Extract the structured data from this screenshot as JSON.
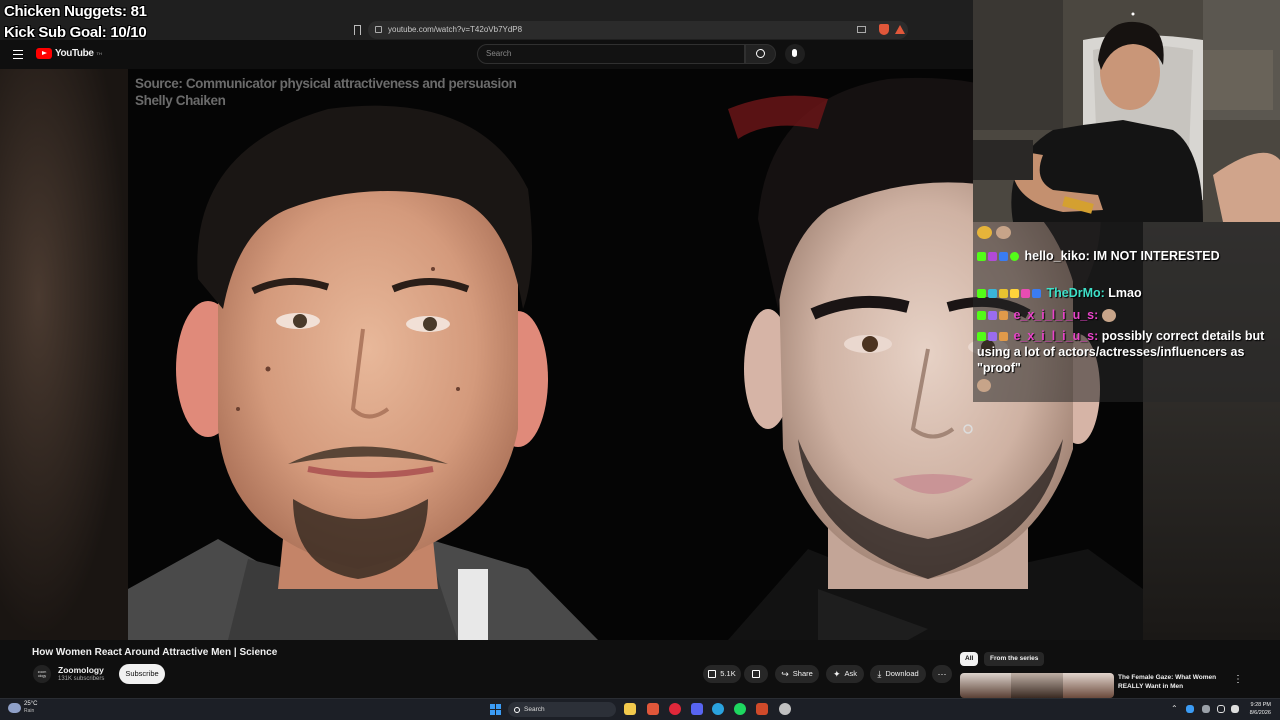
{
  "stream_overlay": {
    "nuggets": "Chicken Nuggets: 81",
    "kick_goal": "Kick Sub Goal: 10/10"
  },
  "browser": {
    "url": "youtube.com/watch?v=T42oVb7YdP8"
  },
  "youtube_header": {
    "logo_text": "YouTube",
    "logo_sup": "TH",
    "search_placeholder": "Search"
  },
  "video": {
    "source_line1": "Source: Communicator physical attractiveness and persuasion",
    "source_line2": "Shelly Chaiken",
    "title": "How Women React Around Attractive Men | Science"
  },
  "channel": {
    "logo_text": "zoom ology",
    "name": "Zoomology",
    "subscribers": "131K subscribers",
    "subscribe_label": "Subscribe"
  },
  "actions": {
    "likes": "5.1K",
    "share": "Share",
    "ask": "Ask",
    "download": "Download"
  },
  "sidebar": {
    "chips": [
      "All",
      "From the series"
    ],
    "rec_title": "The Female Gaze: What Women REALLY Want in Men"
  },
  "chat": {
    "messages": [
      {
        "user": "hello_kiko:",
        "text": "IM NOT INTERESTED",
        "color": "#ffffff"
      },
      {
        "user": "TheDrMo:",
        "text": "Lmao",
        "color": "#3ee0c8"
      },
      {
        "user": "e_x_i_l_i_u_s:",
        "text": "",
        "color": "#e844c8"
      },
      {
        "user": "e_x_i_l_i_u_s:",
        "text": "possibly correct details but using a lot of actors/actresses/influencers as \"proof\"",
        "color": "#e844c8"
      }
    ]
  },
  "taskbar": {
    "weather_temp": "25°C",
    "weather_desc": "Rain",
    "search_label": "Search",
    "time": "9:28 PM",
    "date": "8/6/2026"
  },
  "colors": {
    "accent_red": "#ff0000",
    "kick_green": "#53fc18",
    "windows_blue": "#3b9cf5"
  }
}
